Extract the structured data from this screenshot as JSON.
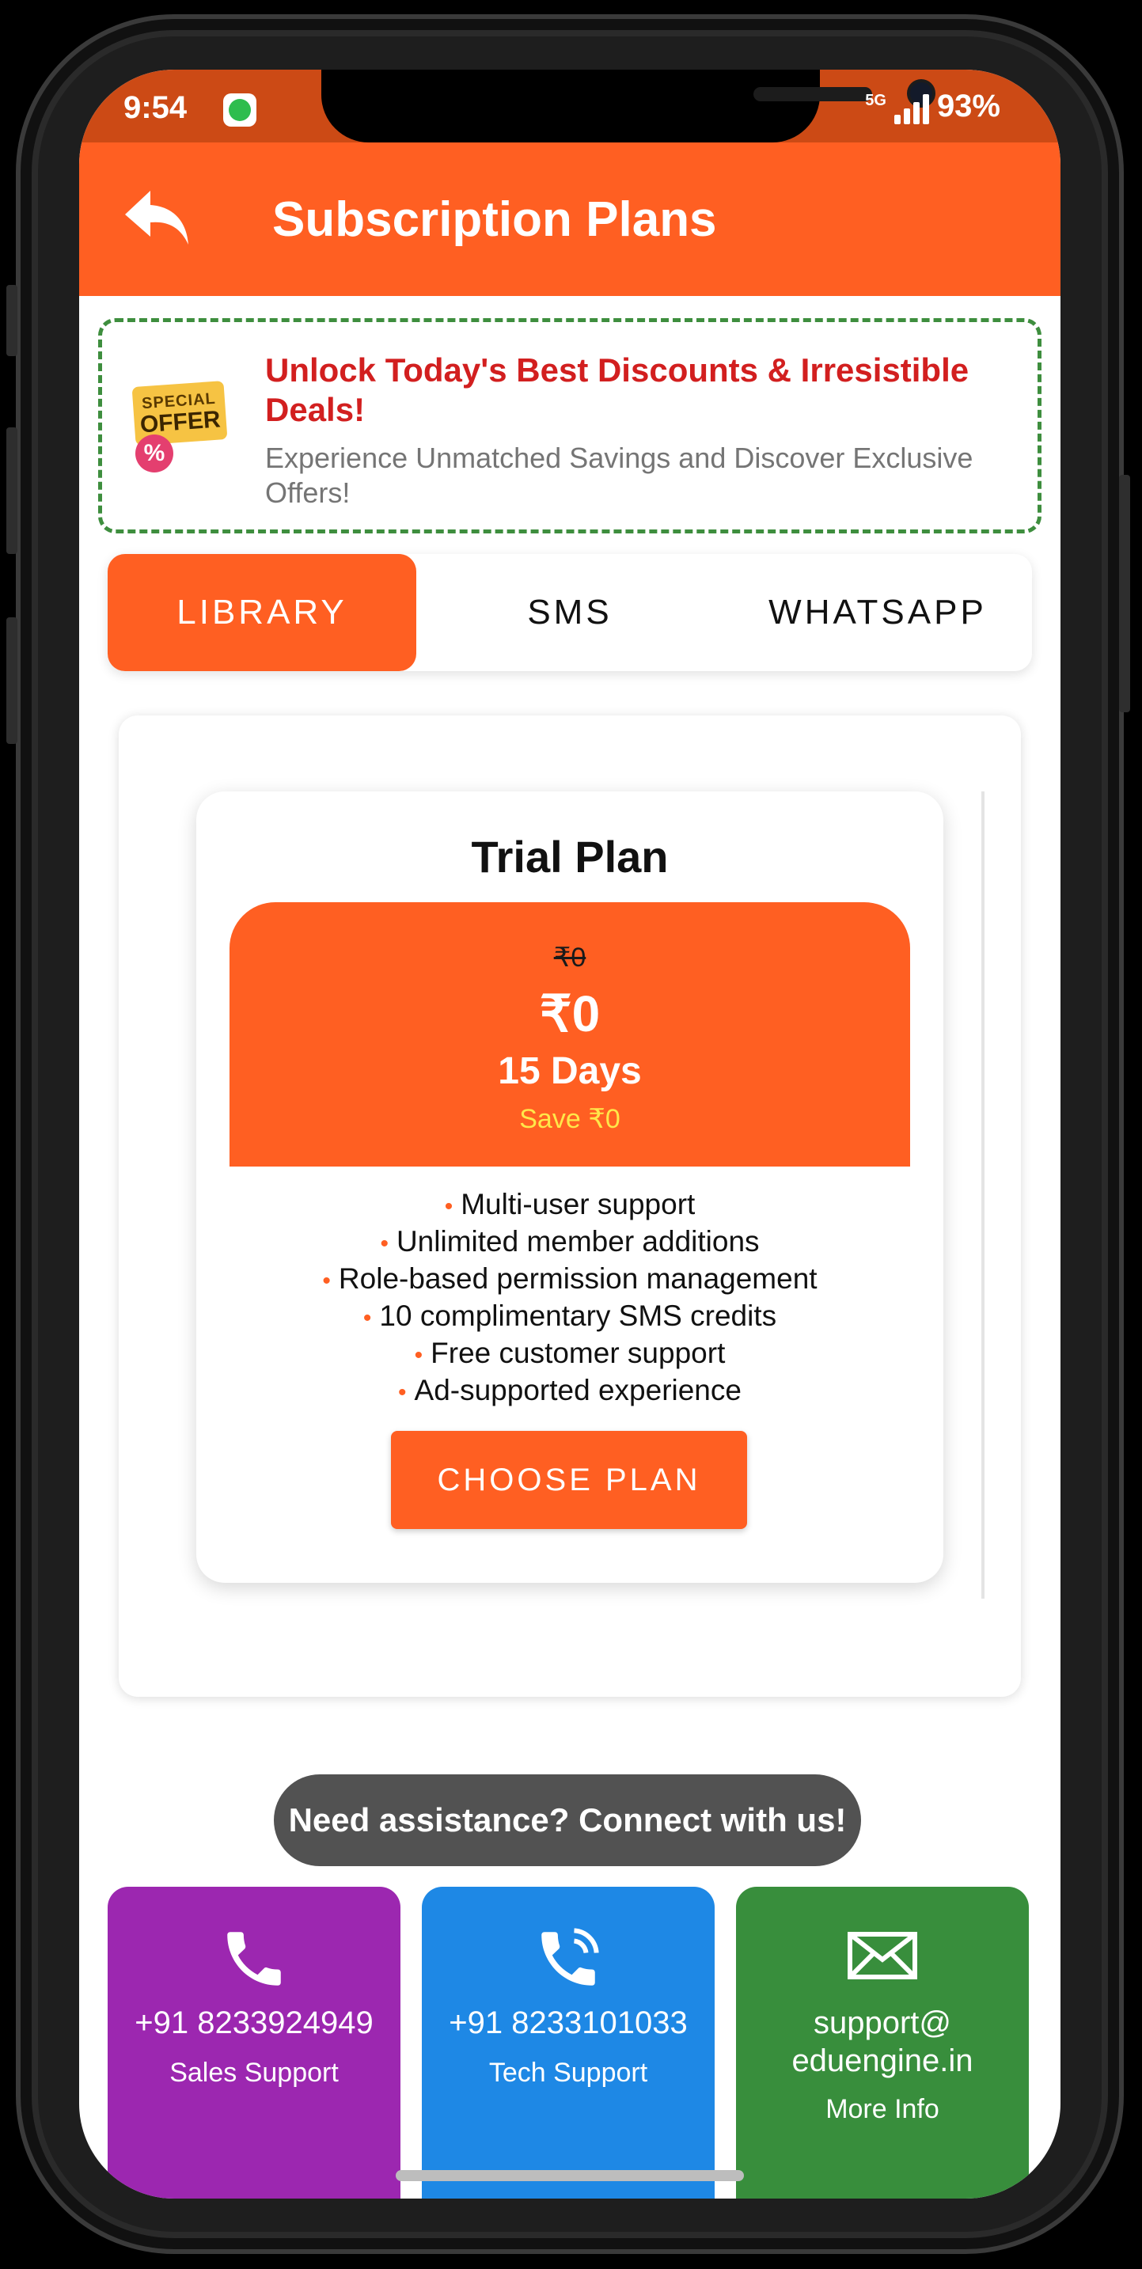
{
  "status": {
    "time": "9:54",
    "network": "5G",
    "battery": "93%"
  },
  "appbar": {
    "title": "Subscription Plans"
  },
  "offer": {
    "badge_line1": "SPECIAL",
    "badge_line2": "OFFER",
    "badge_symbol": "%",
    "title": "Unlock Today's Best Discounts & Irresistible Deals!",
    "subtitle": "Experience Unmatched Savings and Discover Exclusive Offers!"
  },
  "tabs": [
    {
      "label": "LIBRARY",
      "active": true
    },
    {
      "label": "SMS",
      "active": false
    },
    {
      "label": "WHATSAPP",
      "active": false
    }
  ],
  "plan": {
    "title": "Trial Plan",
    "original_price": "₹0",
    "price": "₹0",
    "duration": "15 Days",
    "savings": "Save ₹0",
    "features": [
      "Multi-user support",
      "Unlimited member additions",
      "Role-based permission management",
      "10 complimentary SMS credits",
      "Free customer support",
      "Ad-supported experience"
    ],
    "button_label": "CHOOSE PLAN"
  },
  "assist": {
    "label": "Need assistance? Connect with us!"
  },
  "contacts": [
    {
      "main": "+91 8233924949",
      "sub": "Sales Support",
      "color": "#9c27b0",
      "icon": "phone-icon"
    },
    {
      "main": "+91 8233101033",
      "sub": "Tech Support",
      "color": "#1e88e5",
      "icon": "phone-ringing-icon"
    },
    {
      "main_line1": "support@",
      "main_line2": "eduengine.in",
      "sub": "More Info",
      "color": "#388e3c",
      "icon": "mail-icon"
    }
  ],
  "colors": {
    "primary": "#ff5f22",
    "status_bar": "#cc4a15",
    "offer_border": "#3e8e3e",
    "offer_title": "#d21f1f",
    "savings": "#ffe74a"
  }
}
